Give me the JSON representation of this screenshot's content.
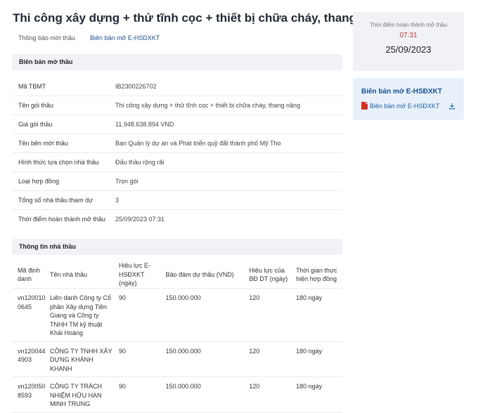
{
  "page": {
    "title": "Thi công xây dựng + thử tĩnh cọc + thiết bị chữa cháy, thang nâng"
  },
  "tabs": [
    {
      "label": "Thông báo mời thầu",
      "active": false
    },
    {
      "label": "Biên bản mở E-HSDXKT",
      "active": true
    }
  ],
  "opening_minutes": {
    "header": "Biên bản mở thầu",
    "rows": [
      {
        "label": "Mã TBMT",
        "value": "IB2300226702"
      },
      {
        "label": "Tên gói thầu",
        "value": "Thi công xây dựng + thử tĩnh cọc + thiết bị chữa cháy, thang nâng"
      },
      {
        "label": "Giá gói thầu",
        "value": "11.948.638.894 VND"
      },
      {
        "label": "Tên bên mời thầu",
        "value": "Ban Quản lý dự án và Phát triển quỹ đất thành phố Mỹ Tho"
      },
      {
        "label": "Hình thức lựa chọn nhà thầu",
        "value": "Đấu thầu rộng rãi"
      },
      {
        "label": "Loại hợp đồng",
        "value": "Trọn gói"
      },
      {
        "label": "Tổng số nhà thầu tham dự",
        "value": "3"
      },
      {
        "label": "Thời điểm hoàn thành mở thầu",
        "value": "25/09/2023 07:31"
      }
    ]
  },
  "bidders": {
    "header": "Thông tin nhà thầu",
    "columns": [
      "Mã định danh",
      "Tên nhà thầu",
      "Hiệu lực E-HSĐXKT (ngày)",
      "Bảo đảm dự thầu (VND)",
      "Hiệu lực của BĐ DT (ngày)",
      "Thời gian thực hiện hợp đồng"
    ],
    "rows": [
      {
        "id": "vn1200100645",
        "name": "Liên danh Công ty Cổ phần Xây dựng Tiền Giang và Công ty TNHH TM kỹ thuật Khải Hoàng",
        "validity": "90",
        "guarantee": "150.000.000",
        "guarantee_validity": "120",
        "duration": "180 ngày"
      },
      {
        "id": "vn1200444903",
        "name": "CÔNG TY TNHH XÂY DỰNG KHÁNH KHANH",
        "validity": "90",
        "guarantee": "150.000.000",
        "guarantee_validity": "120",
        "duration": "180 ngày"
      },
      {
        "id": "vn1200508593",
        "name": "CÔNG TY TRÁCH NHIỆM HỮU HẠN MINH TRUNG",
        "validity": "90",
        "guarantee": "150.000.000",
        "guarantee_validity": "120",
        "duration": "180 ngày"
      }
    ]
  },
  "sidebar": {
    "completion_label": "Thời điểm hoàn thành mở thầu",
    "completion_time": "07:31",
    "completion_date": "25/09/2023",
    "document_title": "Biên bản mở E-HSĐXKT",
    "document_link": "Biên bản mở E-HSĐXKT",
    "pdf_icon": "pdf-icon",
    "download_icon": "download-icon"
  },
  "colors": {
    "accent": "#1a4f8f",
    "time_red": "#c0392b",
    "pdf_red": "#d93025"
  }
}
